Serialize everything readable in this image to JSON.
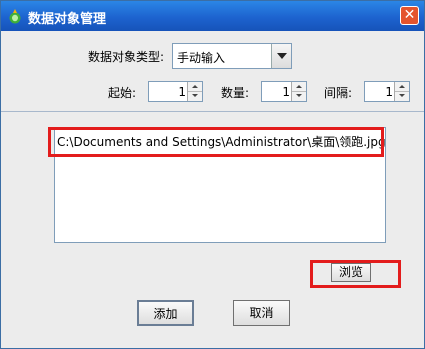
{
  "window": {
    "title": "数据对象管理",
    "close_symbol": "✕"
  },
  "form": {
    "type_label": "数据对象类型:",
    "type_value": "手动输入",
    "start_label": "起始:",
    "start_value": "1",
    "count_label": "数量:",
    "count_value": "1",
    "interval_label": "间隔:",
    "interval_value": "1"
  },
  "file_list": {
    "path": "C:\\Documents and Settings\\Administrator\\桌面\\领跑.jpg"
  },
  "buttons": {
    "browse": "浏览",
    "add": "添加",
    "cancel": "取消"
  },
  "colors": {
    "title_bar": "#1d63cf",
    "highlight": "#e31c1c"
  }
}
